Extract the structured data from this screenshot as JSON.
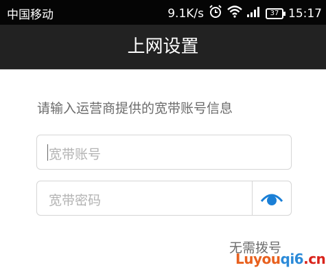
{
  "status_bar": {
    "carrier": "中国移动",
    "speed": "9.1K/s",
    "battery": "37",
    "time": "15:17"
  },
  "title": "上网设置",
  "hint": "请输入运营商提供的宽带账号信息",
  "account": {
    "placeholder": "宽带账号"
  },
  "password": {
    "placeholder": "宽带密码"
  },
  "no_dial_link": "无需拨号",
  "watermark": {
    "part1": "Luyou",
    "part2": "qi6",
    "part3": ".cn"
  },
  "colors": {
    "accent": "#1a7fd6",
    "title_bar": "#222222",
    "status_bar": "#050505"
  }
}
